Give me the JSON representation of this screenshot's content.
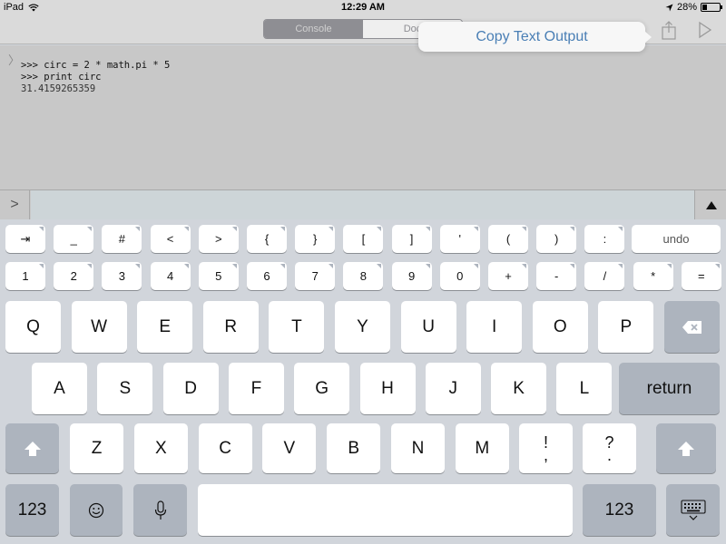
{
  "status_bar": {
    "device": "iPad",
    "time": "12:29 AM",
    "battery": "28%",
    "battery_fraction": 0.28
  },
  "toolbar": {
    "segments": [
      "Console",
      "Doc"
    ],
    "active_segment": "Console",
    "share_icon": "share-icon",
    "run_icon": "play-icon"
  },
  "popover": {
    "label": "Copy Text Output"
  },
  "console": {
    "lines": [
      ">>> circ = 2 * math.pi * 5",
      ">>> print circ",
      "31.4159265359"
    ]
  },
  "input": {
    "prompt": ">",
    "value": ""
  },
  "keyboard": {
    "symbol_row": [
      "⇥",
      "_",
      "#",
      "<",
      ">",
      "{",
      "}",
      "[",
      "]",
      "'",
      "(",
      ")",
      ":",
      "undo"
    ],
    "number_row": [
      "1",
      "2",
      "3",
      "4",
      "5",
      "6",
      "7",
      "8",
      "9",
      "0",
      "+",
      "-",
      "/",
      "*",
      "="
    ],
    "row1": [
      "Q",
      "W",
      "E",
      "R",
      "T",
      "Y",
      "U",
      "I",
      "O",
      "P"
    ],
    "row2": [
      "A",
      "S",
      "D",
      "F",
      "G",
      "H",
      "J",
      "K",
      "L"
    ],
    "row3": [
      "Z",
      "X",
      "C",
      "V",
      "B",
      "N",
      "M"
    ],
    "punct1_top": "!",
    "punct1_bottom": ",",
    "punct2_top": "?",
    "punct2_bottom": ".",
    "return_label": "return",
    "numbers_label": "123"
  }
}
